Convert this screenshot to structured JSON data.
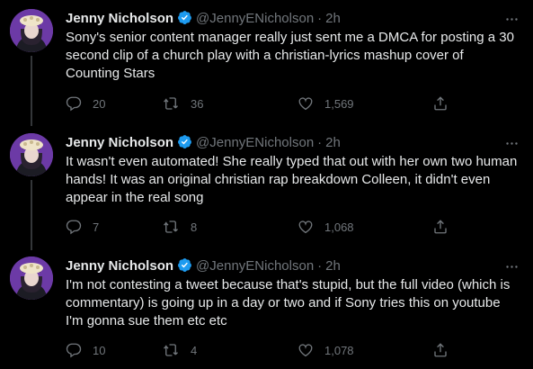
{
  "author": {
    "name": "Jenny Nicholson",
    "handle": "@JennyENicholson",
    "separator": "·"
  },
  "colors": {
    "background": "#000000",
    "text": "#e7e9ea",
    "muted": "#71767b",
    "verified": "#1d9bf0",
    "thread_line": "#333639"
  },
  "icons": {
    "verified": "verified-badge-icon",
    "more": "more-dots-icon",
    "reply": "reply-icon",
    "retweet": "retweet-icon",
    "like": "heart-icon",
    "share": "share-icon"
  },
  "tweets": [
    {
      "time": "2h",
      "text": "Sony's senior content manager really just sent me a DMCA for posting a 30 second clip of a church play with a christian-lyrics mashup cover of Counting Stars",
      "replies": "20",
      "retweets": "36",
      "likes": "1,569"
    },
    {
      "time": "2h",
      "text": "It wasn't even automated! She really typed that out with her own two human hands! It was an original christian rap breakdown Colleen, it didn't even appear in the real song",
      "replies": "7",
      "retweets": "8",
      "likes": "1,068"
    },
    {
      "time": "2h",
      "text": "I'm not contesting a tweet because that's stupid, but the full video (which is commentary) is going up in a day or two and if Sony tries this on youtube I'm gonna sue them etc etc",
      "replies": "10",
      "retweets": "4",
      "likes": "1,078"
    }
  ]
}
